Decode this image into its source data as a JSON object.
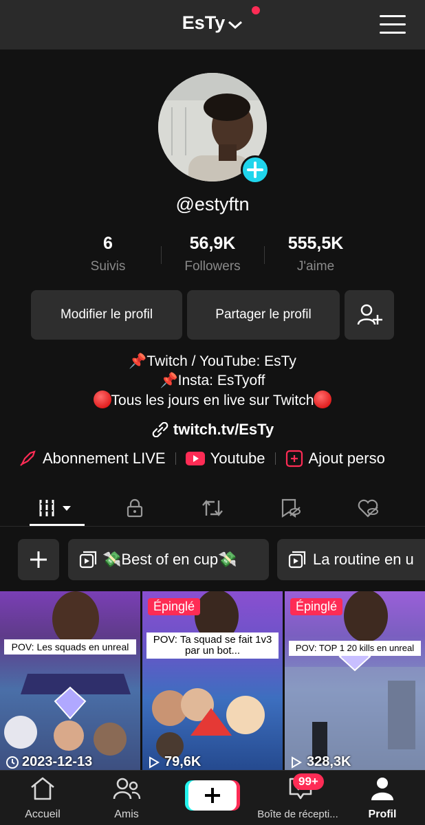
{
  "header": {
    "title": "EsTy"
  },
  "profile": {
    "username": "@estyftn",
    "stats": [
      {
        "value": "6",
        "label": "Suivis"
      },
      {
        "value": "56,9K",
        "label": "Followers"
      },
      {
        "value": "555,5K",
        "label": "J'aime"
      }
    ],
    "edit_label": "Modifier le profil",
    "share_label": "Partager le profil",
    "bio": [
      "Twitch / YouTube: EsTy",
      "Insta: EsTyoff",
      "Tous les jours en live sur Twitch"
    ],
    "link": "twitch.tv/EsTy",
    "quick_links": [
      "Abonnement LIVE",
      "Youtube",
      "Ajout perso"
    ]
  },
  "playlists": [
    "Best of en cup",
    "La routine en u"
  ],
  "videos": [
    {
      "pinned": "",
      "caption": "POV: Les squads en unreal",
      "meta": "2023-12-13",
      "meta_icon": "clock-icon"
    },
    {
      "pinned": "Épinglé",
      "caption": "POV: Ta squad se fait 1v3 par un bot...",
      "meta": "79,6K",
      "meta_icon": "play-icon"
    },
    {
      "pinned": "Épinglé",
      "caption": "POV: TOP 1 20 kills en unreal",
      "meta": "328,3K",
      "meta_icon": "play-icon"
    }
  ],
  "nav": {
    "home": "Accueil",
    "friends": "Amis",
    "inbox": "Boîte de récepti...",
    "inbox_badge": "99+",
    "profile": "Profil"
  },
  "colors": {
    "accent": "#fe2c55",
    "cyan": "#20d5ec",
    "background": "#121212"
  }
}
